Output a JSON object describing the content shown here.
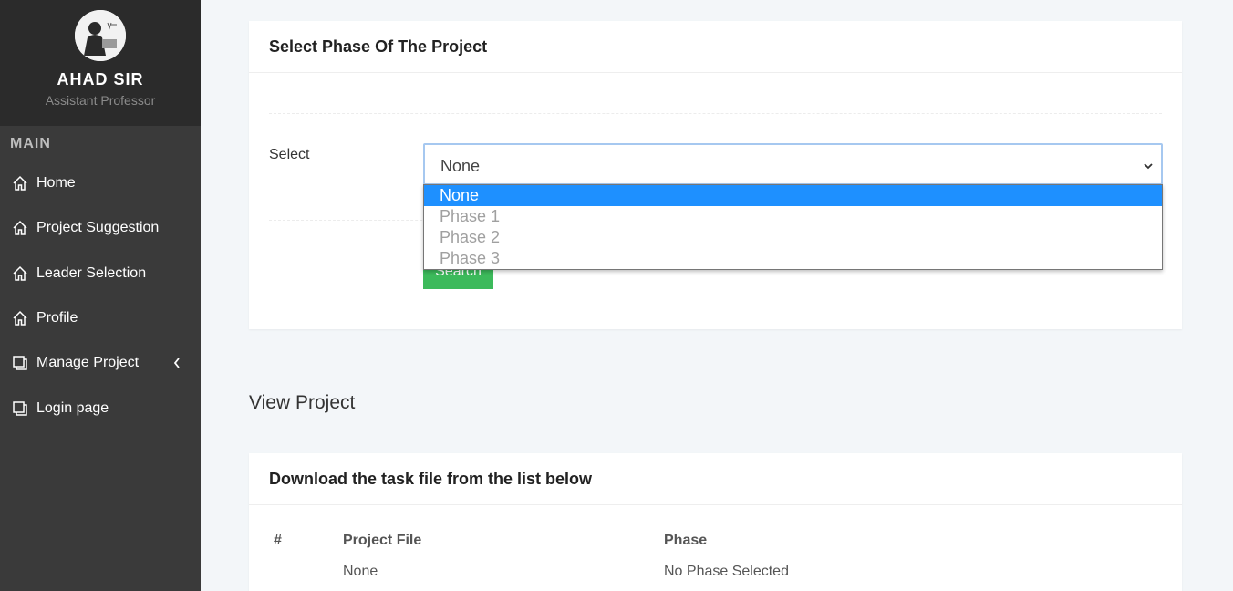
{
  "sidebar": {
    "user_name": "AHAD SIR",
    "user_role": "Assistant Professor",
    "section_label": "MAIN",
    "items": [
      {
        "label": "Home",
        "icon": "home-icon"
      },
      {
        "label": "Project Suggestion",
        "icon": "home-icon"
      },
      {
        "label": "Leader Selection",
        "icon": "home-icon"
      },
      {
        "label": "Profile",
        "icon": "home-icon"
      },
      {
        "label": "Manage Project",
        "icon": "copy-icon",
        "has_submenu": true
      },
      {
        "label": "Login page",
        "icon": "copy-icon"
      }
    ]
  },
  "phase_card": {
    "title": "Select Phase Of The Project",
    "select_label": "Select",
    "select_value": "None",
    "options": [
      "None",
      "Phase 1",
      "Phase 2",
      "Phase 3"
    ],
    "highlighted_option": "None",
    "search_button": "Search"
  },
  "view_title": "View Project",
  "task_card": {
    "title": "Download the task file from the list below",
    "columns": [
      "#",
      "Project File",
      "Phase"
    ],
    "rows": [
      {
        "num": "",
        "file": "None",
        "phase": "No Phase Selected"
      }
    ]
  },
  "colors": {
    "sidebar_bg": "#3a3a3a",
    "sidebar_header_bg": "#2b2b2b",
    "accent": "#1e90ff",
    "button_green": "#3cba5b"
  }
}
